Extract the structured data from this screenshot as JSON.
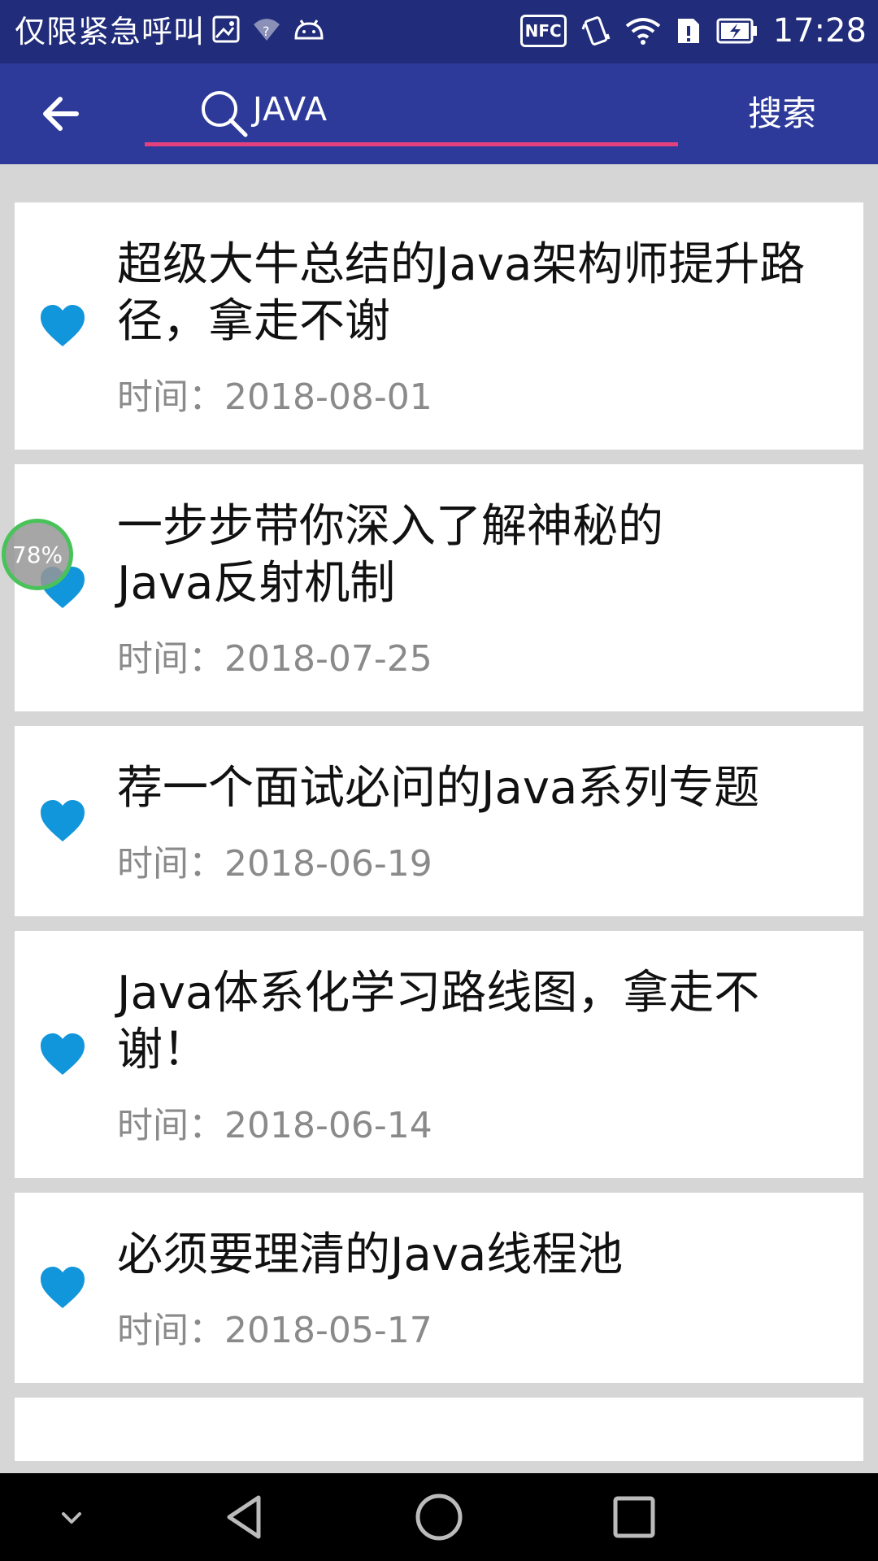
{
  "status_bar": {
    "carrier": "仅限紧急呼叫",
    "nfc": "NFC",
    "time": "17:28"
  },
  "toolbar": {
    "search_value": "JAVA",
    "search_button": "搜索"
  },
  "articles": [
    {
      "title": "超级大牛总结的Java架构师提升路径，拿走不谢",
      "time": "时间：2018-08-01"
    },
    {
      "title": "一步步带你深入了解神秘的Java反射机制",
      "time": "时间：2018-07-25"
    },
    {
      "title": "荐一个面试必问的Java系列专题",
      "time": "时间：2018-06-19"
    },
    {
      "title": "Java体系化学习路线图，拿走不谢！",
      "time": "时间：2018-06-14"
    },
    {
      "title": "必须要理清的Java线程池",
      "time": "时间：2018-05-17"
    }
  ],
  "floating_badge": {
    "label": "78%"
  },
  "colors": {
    "status_bar": "#212c7a",
    "toolbar": "#2d3a9a",
    "search_underline": "#e5407e",
    "heart": "#1296db"
  }
}
